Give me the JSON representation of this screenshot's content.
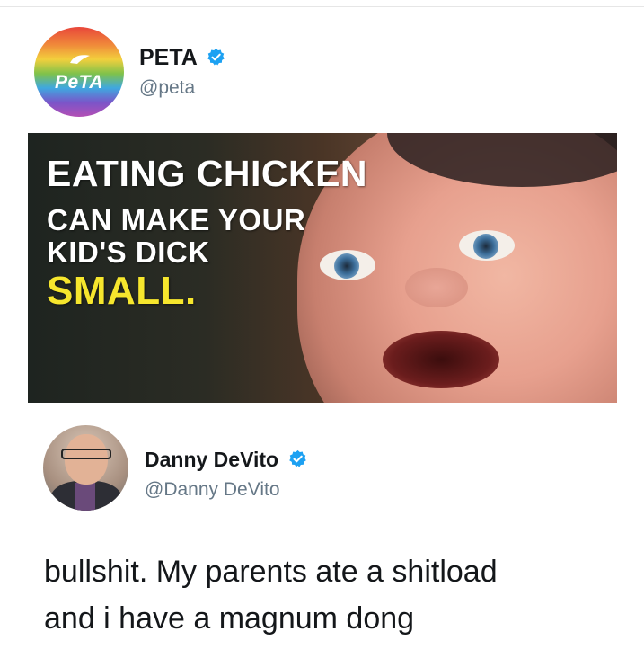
{
  "tweet1": {
    "display_name": "PETA",
    "handle": "@peta",
    "avatar_text": "PeTA",
    "verified_icon": "verified-badge-icon",
    "image": {
      "caption_line1": "EATING CHICKEN",
      "caption_line2": "CAN MAKE YOUR",
      "caption_line3": "KID'S DICK",
      "caption_line4": "SMALL."
    }
  },
  "tweet2": {
    "display_name": "Danny DeVito",
    "handle": "@Danny DeVito",
    "verified_icon": "verified-badge-icon",
    "text_line1": "bullshit. My parents ate a shitload",
    "text_line2": "and i have a magnum dong"
  },
  "colors": {
    "verified": "#1da1f2",
    "caption_accent": "#f6e62d",
    "handle": "#657786"
  }
}
